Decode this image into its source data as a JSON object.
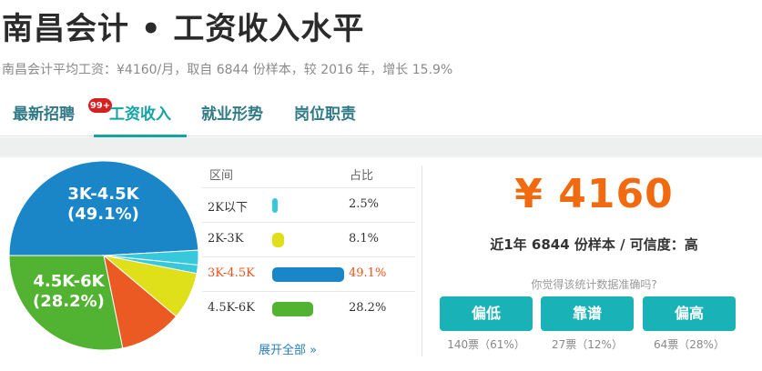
{
  "header": {
    "title": "南昌会计 • 工资收入水平",
    "subtitle": "南昌会计平均工资：¥4160/月，取自 6844 份样本，较 2016 年，增长 15.9%"
  },
  "tabs": [
    {
      "label": "最新招聘",
      "badge": "99+"
    },
    {
      "label": "工资收入",
      "active": true
    },
    {
      "label": "就业形势"
    },
    {
      "label": "岗位职责"
    }
  ],
  "pie_labels": {
    "slice_3k_45k": "3K-4.5K",
    "slice_3k_45k_pct": "(49.1%)",
    "slice_45k_6k": "4.5K-6K",
    "slice_45k_6k_pct": "(28.2%)"
  },
  "table": {
    "col_range": "区间",
    "col_share": "占比",
    "rows": [
      {
        "range": "2K以下",
        "pct": "2.5%",
        "color": "#38c8dc"
      },
      {
        "range": "2K-3K",
        "pct": "8.1%",
        "color": "#e0e01a"
      },
      {
        "range": "3K-4.5K",
        "pct": "49.1%",
        "color": "#1a86c8"
      },
      {
        "range": "4.5K-6K",
        "pct": "28.2%",
        "color": "#52b332"
      }
    ],
    "expand": "展开全部 »"
  },
  "summary": {
    "salary": "¥ 4160",
    "sample_info": "近1年 6844 份样本 / 可信度：高",
    "question": "你觉得该统计数据准确吗?",
    "votes": [
      {
        "label": "偏低",
        "count": "140票（61%）"
      },
      {
        "label": "靠谱",
        "count": "27票（12%）"
      },
      {
        "label": "偏高",
        "count": "64票（28%）"
      }
    ]
  },
  "chart_data": {
    "type": "pie",
    "categories": [
      "2K以下",
      "2K-3K",
      "3K-4.5K",
      "4.5K-6K"
    ],
    "values": [
      2.5,
      8.1,
      49.1,
      28.2
    ],
    "colors": [
      "#38c8dc",
      "#e0e01a",
      "#1a86c8",
      "#52b332"
    ],
    "other_slice_colors": [
      "#ea5a22",
      "#e0e01a",
      "#38c8dc"
    ],
    "unit": "%"
  },
  "colors": {
    "accent": "#14a3a6",
    "salary": "#f26a10",
    "highlight": "#e8531e",
    "badge": "#d81e1e"
  }
}
